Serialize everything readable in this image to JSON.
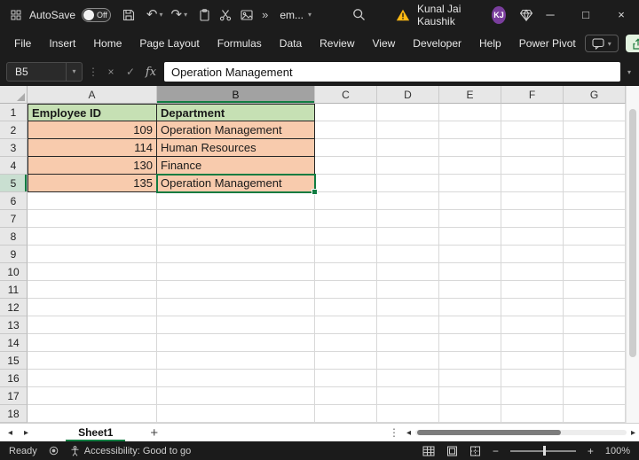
{
  "title_bar": {
    "autosave_label": "AutoSave",
    "autosave_state": "Off",
    "document_name": "em...",
    "user_name": "Kunal Jai Kaushik",
    "user_initials": "KJ"
  },
  "menu_bar": {
    "items": [
      "File",
      "Insert",
      "Home",
      "Page Layout",
      "Formulas",
      "Data",
      "Review",
      "View",
      "Developer",
      "Help",
      "Power Pivot"
    ]
  },
  "formula_bar": {
    "cell_reference": "B5",
    "fx_label": "fx",
    "formula_value": "Operation Management"
  },
  "sheet": {
    "col_headers": [
      "A",
      "B",
      "C",
      "D",
      "E",
      "F",
      "G"
    ],
    "row_count": 18,
    "selected": {
      "col": "B",
      "row": 5
    },
    "table_headers": [
      "Employee ID",
      "Department"
    ],
    "cells": [
      {
        "row": 1,
        "col": "A",
        "text": "Employee ID",
        "cls": "th"
      },
      {
        "row": 1,
        "col": "B",
        "text": "Department",
        "cls": "th"
      },
      {
        "row": 2,
        "col": "A",
        "text": "109",
        "cls": "td num"
      },
      {
        "row": 2,
        "col": "B",
        "text": "Operation Management",
        "cls": "td"
      },
      {
        "row": 3,
        "col": "A",
        "text": "114",
        "cls": "td num"
      },
      {
        "row": 3,
        "col": "B",
        "text": "Human Resources",
        "cls": "td"
      },
      {
        "row": 4,
        "col": "A",
        "text": "130",
        "cls": "td num"
      },
      {
        "row": 4,
        "col": "B",
        "text": "Finance",
        "cls": "td"
      },
      {
        "row": 5,
        "col": "A",
        "text": "135",
        "cls": "td num"
      },
      {
        "row": 5,
        "col": "B",
        "text": "Operation Management",
        "cls": "td"
      }
    ]
  },
  "tab_bar": {
    "active_tab": "Sheet1"
  },
  "status_bar": {
    "mode": "Ready",
    "accessibility": "Accessibility: Good to go",
    "zoom_level": "100%"
  },
  "colors": {
    "accent_green": "#107C41",
    "table_header_fill": "#C6E0B4",
    "table_data_fill": "#F8CBAD",
    "warning_yellow": "#FDB813",
    "avatar_purple": "#7A3E9D"
  }
}
